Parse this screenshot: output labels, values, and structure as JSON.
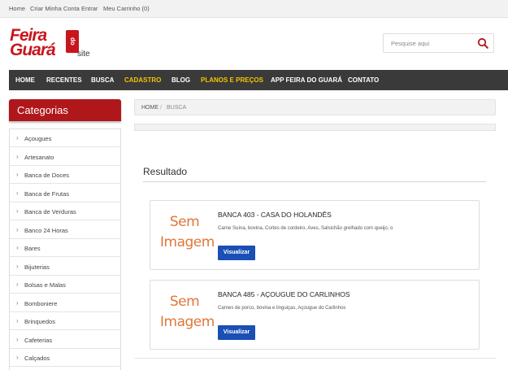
{
  "topbar": {
    "links": [
      "Home",
      "Criar Minha Conta",
      "Entrar",
      "Meu Carrinho (0)"
    ]
  },
  "logo": {
    "feira": "Feira",
    "guara": "Guará",
    "do": "do",
    "site": "site"
  },
  "search": {
    "placeholder": "Pesquise aqui",
    "icon": "magnifier-icon",
    "icon_color": "#b0171b"
  },
  "nav": {
    "items": [
      {
        "label": "HOME",
        "highlight": false
      },
      {
        "label": "RECENTES",
        "highlight": false
      },
      {
        "label": "BUSCA",
        "highlight": false
      },
      {
        "label": "CADASTRO",
        "highlight": true
      },
      {
        "label": "BLOG",
        "highlight": false
      },
      {
        "label": "PLANOS E PREÇOS",
        "highlight": true
      },
      {
        "label": "APP FEIRA DO GUARÁ",
        "highlight": false
      },
      {
        "label": "CONTATO",
        "highlight": false
      }
    ],
    "bg_color": "#3a3a3a",
    "highlight_color": "#f5c400"
  },
  "sidebar": {
    "title": "Categorias",
    "header_color": "#b0171b",
    "chevron": "›",
    "items": [
      "Açougues",
      "Artesanato",
      "Banca de Doces",
      "Banca de Frutas",
      "Banca de Verduras",
      "Banco 24 Horas",
      "Bares",
      "Bijuterias",
      "Bolsas e Malas",
      "Bomboniere",
      "Brinquedos",
      "Cafeterias",
      "Calçados"
    ]
  },
  "breadcrumb": {
    "home": "HOME",
    "separator": "/",
    "current": "BUSCA"
  },
  "results": {
    "title": "Resultado",
    "items": [
      {
        "placeholder_line1": "Sem",
        "placeholder_line2": "Imagem",
        "name": "BANCA 403 - CASA DO HOLANDÊS",
        "description": "Carne Suína, bovina, Cortes de cordeiro, Aves, Salsichão grelhado com queijo, o",
        "button": "Visualizar"
      },
      {
        "placeholder_line1": "Sem",
        "placeholder_line2": "Imagem",
        "name": "BANCA 485 - AÇOUGUE DO CARLINHOS",
        "description": "Carnes de porco, bovina e linguiças, Açougue do Carlinhos",
        "button": "Visualizar"
      }
    ],
    "button_color": "#1a4fb4",
    "placeholder_color": "#e0763a"
  }
}
